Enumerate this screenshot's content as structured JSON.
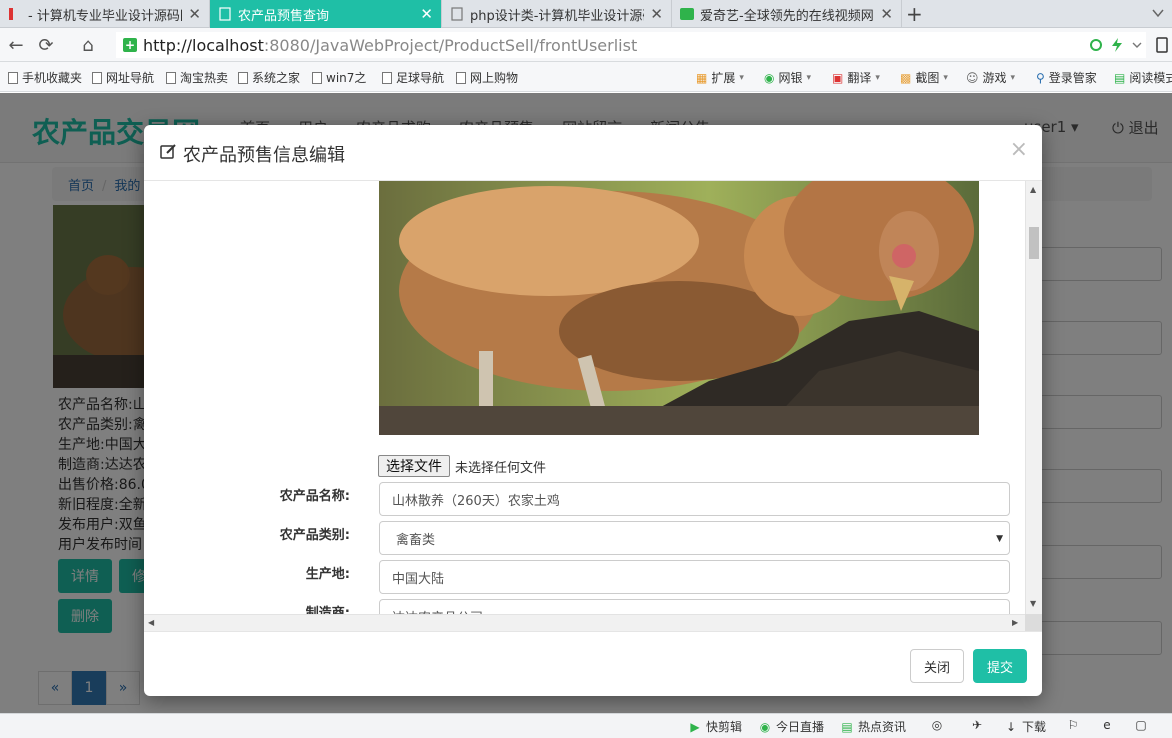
{
  "browser": {
    "tabs": [
      {
        "label": "- 计算机专业毕业设计源码网",
        "active": false
      },
      {
        "label": "农产品预售查询",
        "active": true
      },
      {
        "label": "php设计类-计算机毕业设计源码",
        "active": false
      },
      {
        "label": "爱奇艺-全球领先的在线视频网站",
        "active": false
      }
    ],
    "url_host": "http://localhost",
    "url_rest": ":8080/JavaWebProject/ProductSell/frontUserlist",
    "bookmarks": [
      "手机收藏夹",
      "网址导航",
      "淘宝热卖",
      "系统之家",
      "win7之",
      "足球导航",
      "网上购物"
    ],
    "bookmark_tools": [
      "扩展",
      "网银",
      "翻译",
      "截图",
      "游戏",
      "登录管家",
      "阅读模式"
    ],
    "status_items": [
      "快剪辑",
      "今日直播",
      "热点资讯",
      "下载"
    ]
  },
  "site": {
    "logo": "农产品交易网",
    "nav": [
      "首页",
      "用户",
      "农产品求购",
      "农产品预售",
      "网站留言",
      "新闻公告"
    ],
    "user": "user1 ▾",
    "logout": "退出",
    "breadcrumb": [
      "首页",
      "我的"
    ],
    "card_info": [
      "农产品名称:山",
      "农产品类别:禽",
      "生产地:中国大",
      "制造商:达达农",
      "出售价格:86.0",
      "新旧程度:全新",
      "发布用户:双鱼",
      "用户发布时间"
    ],
    "buttons": {
      "detail": "详情",
      "edit": "修",
      "delete": "删除"
    },
    "pager": {
      "prev": "«",
      "current": "1",
      "next": "»"
    }
  },
  "modal": {
    "title": "农产品预售信息编辑",
    "close_symbol": "×",
    "file_button": "选择文件",
    "file_status": "未选择任何文件",
    "fields": [
      {
        "label": "农产品名称:",
        "value": "山林散养（260天）农家土鸡",
        "type": "text"
      },
      {
        "label": "农产品类别:",
        "value": "禽畜类",
        "type": "select"
      },
      {
        "label": "生产地:",
        "value": "中国大陆",
        "type": "text"
      },
      {
        "label": "制造商:",
        "value": "达达农产品公司",
        "type": "text"
      }
    ],
    "footer": {
      "close": "关闭",
      "submit": "提交"
    }
  },
  "colors": {
    "accent": "#1fbfa6",
    "link": "#2a6fb0",
    "pager_active": "#337ab7"
  }
}
